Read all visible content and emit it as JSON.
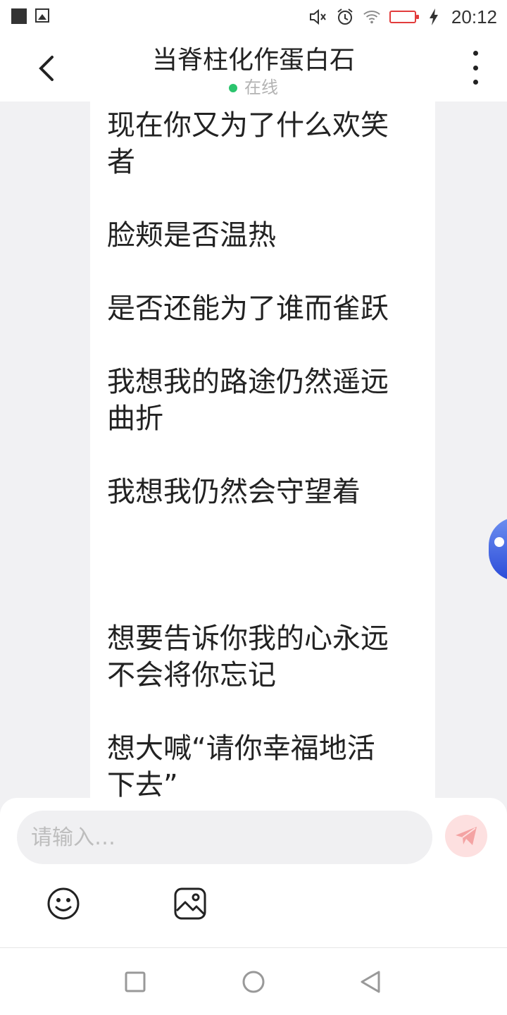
{
  "status_bar": {
    "time": "20:12",
    "icons": [
      "notification-square-icon",
      "gallery-icon",
      "mute-icon",
      "alarm-icon",
      "wifi-icon",
      "battery-low-icon",
      "charging-icon"
    ],
    "battery_color": "#e23c3c"
  },
  "header": {
    "title": "当脊柱化作蛋白石",
    "status": "在线",
    "status_color": "#2bc46d"
  },
  "message": {
    "lines": [
      "现在你又为了什么欢笑",
      "者",
      "脸颊是否温热",
      "是否还能为了谁而雀跃",
      "我想我的路途仍然遥远",
      "曲折",
      "我想我仍然会守望着",
      "想要告诉你我的心永远",
      "不会将你忘记",
      "想大喊“请你幸福地活",
      "下去”"
    ]
  },
  "composer": {
    "placeholder": "请输入…",
    "send_icon": "send-icon",
    "emoji_icon": "emoji-icon",
    "image_icon": "image-icon"
  },
  "nav": {
    "buttons": [
      "recent-apps-icon",
      "home-icon",
      "back-nav-icon"
    ]
  }
}
